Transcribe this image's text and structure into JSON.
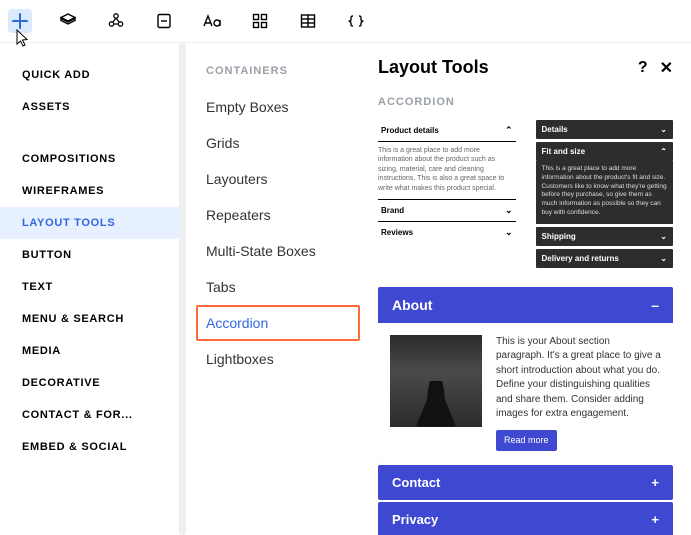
{
  "toolbar": {
    "icons": [
      "plus",
      "layers",
      "molecule",
      "page",
      "typography",
      "grid",
      "table",
      "code"
    ]
  },
  "sidebar1": {
    "groupA": [
      "QUICK ADD",
      "ASSETS"
    ],
    "groupB": [
      "COMPOSITIONS",
      "WIREFRAMES",
      "LAYOUT TOOLS",
      "BUTTON",
      "TEXT",
      "MENU & SEARCH",
      "MEDIA",
      "DECORATIVE",
      "CONTACT & FOR...",
      "EMBED & SOCIAL"
    ],
    "active": "LAYOUT TOOLS"
  },
  "sidebar2": {
    "heading": "CONTAINERS",
    "items": [
      "Empty Boxes",
      "Grids",
      "Layouters",
      "Repeaters",
      "Multi-State Boxes",
      "Tabs",
      "Accordion",
      "Lightboxes"
    ],
    "selected": "Accordion"
  },
  "panel": {
    "title": "Layout Tools",
    "help": "?",
    "close": "✕",
    "sectionLabel": "ACCORDION",
    "lightAcc": {
      "rows": [
        {
          "label": "Product details",
          "open": true,
          "desc": "This is a great place to add more information about the product such as sizing, material, care and cleaning instructions. This is also a great space to write what makes this product special."
        },
        {
          "label": "Brand",
          "open": false
        },
        {
          "label": "Reviews",
          "open": false
        }
      ]
    },
    "darkAcc": {
      "rows": [
        {
          "label": "Details",
          "open": false
        },
        {
          "label": "Fit and size",
          "open": true,
          "desc": "This is a great place to add more information about the product's fit and size. Customers like to know what they're getting before they purchase, so give them as much information as possible so they can buy with confidence."
        },
        {
          "label": "Shipping",
          "open": false
        },
        {
          "label": "Delivery and returns",
          "open": false
        }
      ]
    },
    "about": {
      "title": "About",
      "toggle": "–",
      "paragraph": "This is your About section paragraph. It's a great place to give a short introduction about what you do. Define your distinguishing qualities and share them. Consider adding images for extra engagement.",
      "button": "Read more"
    },
    "extra": [
      {
        "label": "Contact",
        "toggle": "+"
      },
      {
        "label": "Privacy",
        "toggle": "+"
      }
    ]
  }
}
